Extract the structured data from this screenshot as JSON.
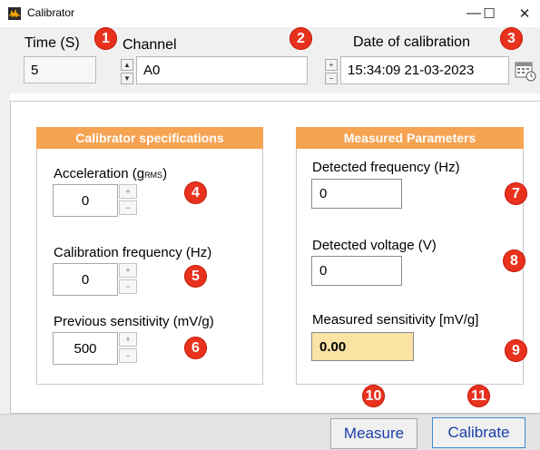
{
  "window": {
    "title": "Calibrator",
    "minimize_glyph": "—",
    "maximize_glyph": "☐",
    "close_glyph": "✕"
  },
  "header": {
    "time_label": "Time (S)",
    "time_value": "5",
    "channel_label": "Channel",
    "channel_value": "A0",
    "date_label": "Date of calibration",
    "date_value": "15:34:09 21-03-2023"
  },
  "spin": {
    "up": "▲",
    "down": "▼",
    "plus": "+",
    "minus": "−"
  },
  "calibrator_specs": {
    "title": "Calibrator specifications",
    "acceleration_label": "Acceleration (g",
    "acceleration_sub": "RMS",
    "acceleration_close": ")",
    "acceleration_value": "0",
    "frequency_label": "Calibration frequency (Hz)",
    "frequency_value": "0",
    "sensitivity_label": "Previous sensitivity (mV/g)",
    "sensitivity_value": "500"
  },
  "measured": {
    "title": "Measured Parameters",
    "freq_label": "Detected frequency (Hz)",
    "freq_value": "0",
    "voltage_label": "Detected voltage (V)",
    "voltage_value": "0",
    "sensitivity_label": "Measured sensitivity [mV/g]",
    "sensitivity_value": "0.00"
  },
  "buttons": {
    "measure": "Measure",
    "calibrate": "Calibrate"
  },
  "badges": [
    "1",
    "2",
    "3",
    "4",
    "5",
    "6",
    "7",
    "8",
    "9",
    "10",
    "11"
  ],
  "colors": {
    "accent_orange": "#f6a352",
    "badge_red": "#e8321e",
    "button_text": "#1a3ea8",
    "highlight_field": "#fbe3a4"
  }
}
